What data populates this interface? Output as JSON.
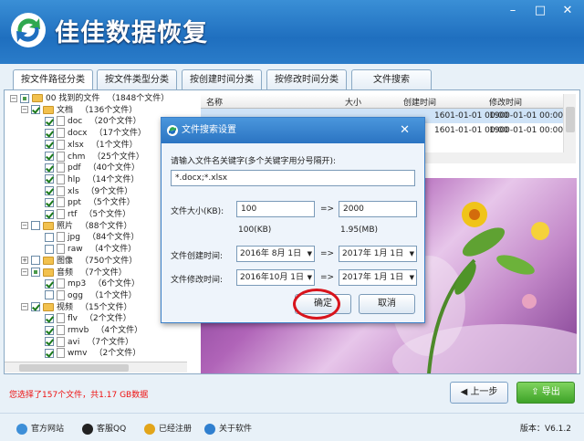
{
  "app": {
    "title": "佳佳数据恢复",
    "window_controls": [
      "–",
      "□",
      "✕"
    ]
  },
  "tabs": [
    {
      "label": "按文件路径分类",
      "active": true
    },
    {
      "label": "按文件类型分类"
    },
    {
      "label": "按创建时间分类"
    },
    {
      "label": "按修改时间分类"
    },
    {
      "label": "文件搜索"
    }
  ],
  "tree": [
    {
      "depth": 0,
      "exp": "−",
      "check": "partial",
      "icon": "root",
      "label": "00 找到的文件",
      "count": "（1848个文件）"
    },
    {
      "depth": 1,
      "exp": "−",
      "check": "on",
      "icon": "folder",
      "label": "文档",
      "count": "（136个文件）"
    },
    {
      "depth": 2,
      "check": "on",
      "icon": "file",
      "label": "doc",
      "count": "（20个文件）"
    },
    {
      "depth": 2,
      "check": "on",
      "icon": "file",
      "label": "docx",
      "count": "（17个文件）"
    },
    {
      "depth": 2,
      "check": "on",
      "icon": "file",
      "label": "xlsx",
      "count": "（1个文件）"
    },
    {
      "depth": 2,
      "check": "on",
      "icon": "file",
      "label": "chm",
      "count": "（25个文件）"
    },
    {
      "depth": 2,
      "check": "on",
      "icon": "file",
      "label": "pdf",
      "count": "（40个文件）"
    },
    {
      "depth": 2,
      "check": "on",
      "icon": "file",
      "label": "hlp",
      "count": "（14个文件）"
    },
    {
      "depth": 2,
      "check": "on",
      "icon": "file",
      "label": "xls",
      "count": "（9个文件）"
    },
    {
      "depth": 2,
      "check": "on",
      "icon": "file",
      "label": "ppt",
      "count": "（5个文件）"
    },
    {
      "depth": 2,
      "check": "on",
      "icon": "file",
      "label": "rtf",
      "count": "（5个文件）"
    },
    {
      "depth": 1,
      "exp": "−",
      "check": "off",
      "icon": "folder",
      "label": "照片",
      "count": "（88个文件）"
    },
    {
      "depth": 2,
      "check": "off",
      "icon": "file",
      "label": "jpg",
      "count": "（84个文件）"
    },
    {
      "depth": 2,
      "check": "off",
      "icon": "file",
      "label": "raw",
      "count": "（4个文件）"
    },
    {
      "depth": 1,
      "exp": "+",
      "check": "off",
      "icon": "folder",
      "label": "图像",
      "count": "（750个文件）"
    },
    {
      "depth": 1,
      "exp": "−",
      "check": "partial",
      "icon": "folder",
      "label": "音频",
      "count": "（7个文件）"
    },
    {
      "depth": 2,
      "check": "on",
      "icon": "file",
      "label": "mp3",
      "count": "（6个文件）"
    },
    {
      "depth": 2,
      "check": "off",
      "icon": "file",
      "label": "ogg",
      "count": "（1个文件）"
    },
    {
      "depth": 1,
      "exp": "−",
      "check": "on",
      "icon": "folder",
      "label": "视频",
      "count": "（15个文件）"
    },
    {
      "depth": 2,
      "check": "on",
      "icon": "file",
      "label": "flv",
      "count": "（2个文件）"
    },
    {
      "depth": 2,
      "check": "on",
      "icon": "file",
      "label": "rmvb",
      "count": "（4个文件）"
    },
    {
      "depth": 2,
      "check": "on",
      "icon": "file",
      "label": "avi",
      "count": "（7个文件）"
    },
    {
      "depth": 2,
      "check": "on",
      "icon": "file",
      "label": "wmv",
      "count": "（2个文件）"
    }
  ],
  "list": {
    "columns": [
      "名称",
      "大小",
      "创建时间",
      "修改时间"
    ],
    "rows": [
      {
        "created": "1601-01-01 00:00",
        "modified": "1900-01-01 00:00",
        "selected": true
      },
      {
        "created": "1601-01-01 00:00",
        "modified": "1900-01-01 00:00"
      }
    ]
  },
  "dialog": {
    "title": "文件搜索设置",
    "keyword_label": "请输入文件名关键字(多个关键字用分号隔开):",
    "keyword_value": "*.docx;*.xlsx",
    "size_label": "文件大小(KB):",
    "size_min": "100",
    "size_max": "2000",
    "size_arrow": "=>",
    "size_min_hint": "100(KB)",
    "size_max_hint": "1.95(MB)",
    "ctime_label": "文件创建时间:",
    "ctime_from": "2016年 8月 1日",
    "ctime_to": "2017年 1月 1日",
    "mtime_label": "文件修改时间:",
    "mtime_from": "2016年10月 1日",
    "mtime_to": "2017年 1月 1日",
    "arrow": "=>",
    "ok": "确定",
    "cancel": "取消",
    "close": "✕"
  },
  "status": "您选择了157个文件，共1.17 GB数据",
  "buttons": {
    "prev": "上一步",
    "export": "导出"
  },
  "footer": {
    "links": [
      "官方网站",
      "客服QQ",
      "已经注册",
      "关于软件"
    ],
    "version_label": "版本：",
    "version": "V6.1.2"
  },
  "colors": {
    "titlebar": "#2a7cc9",
    "highlight": "#d8141c",
    "export": "#3ea328"
  }
}
